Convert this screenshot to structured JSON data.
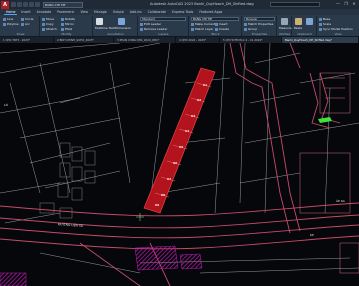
{
  "app": {
    "logo_letter": "A",
    "layer_current": "BANG CHI TIE",
    "title": "Autodesk AutoCAD 2023   Banhi_QuyHoach_DH_Shifted.dwg"
  },
  "window_controls": [
    "—",
    "❐",
    "✕"
  ],
  "tabs": [
    "Home",
    "Insert",
    "Annotate",
    "Parametric",
    "View",
    "Manage",
    "Output",
    "Add-ins",
    "Collaborate",
    "Express Tools",
    "Featured Apps"
  ],
  "active_tab": "Home",
  "ribbon": {
    "draw_items": [
      "Line",
      "Polyline",
      "Circle",
      "Arc"
    ],
    "modify_items": [
      "Move",
      "Copy",
      "Stretch",
      "Rotate",
      "Mirror",
      "Fillet"
    ],
    "layer_combo": "BANG CHI TIE",
    "layer_items": [
      "Make Current",
      "Match Layer"
    ],
    "annotation_items": [
      "Multiline Text",
      "Dimension"
    ],
    "annotation_style": "Standard",
    "annotation_sub": [
      "Edit Leader",
      "Remove Leader"
    ],
    "block_items": [
      "Insert",
      "Create",
      "Edit",
      "Edit Attributes"
    ],
    "block_combo": "Standard",
    "properties_combo": "ByLayer",
    "properties_items": [
      "Match Properties",
      "Group"
    ],
    "groups_label": "Groups",
    "utilities_items": [
      "Measure"
    ],
    "clipboard_items": [
      "Paste",
      "Copy Clip"
    ],
    "view_items": [
      "Base",
      "Scale",
      "Sync Model Position"
    ],
    "group_labels": [
      "Draw",
      "Modify",
      "Annotation",
      "Layers",
      "Block",
      "Properties",
      "Groups",
      "Utilities",
      "Clipboard",
      "View"
    ]
  },
  "file_tabs": [
    "1 QHC TRT3 - 2023*",
    "2 BDH CHINH_SUHO_2023*",
    "3 PHAN VUNG QH2_2024_QHC*",
    "4 QHC 2024 - 2025*",
    "5 QH HCTM HLC 2 - C1.2024*",
    "Banhi_QuyHoach_DH_Shifted.dwg*"
  ],
  "active_file_tab": 5,
  "drawing_labels": {
    "lot_numbers": [
      "01",
      "02",
      "03",
      "04",
      "05",
      "06",
      "07",
      "08",
      "09"
    ],
    "road_label": "ĐƯỜNG LIÊN XÃ",
    "village_label": "ẤP 6A",
    "left_label": "LÔ",
    "right_label": "KP"
  },
  "colors": {
    "highlight_fill": "#b3131d",
    "highlight_stroke": "#ff4a4a",
    "road_line": "#c64b68",
    "lot_line": "#c8c8c8",
    "hatch": "#c01ab5",
    "accent": "#4ea3ff"
  }
}
